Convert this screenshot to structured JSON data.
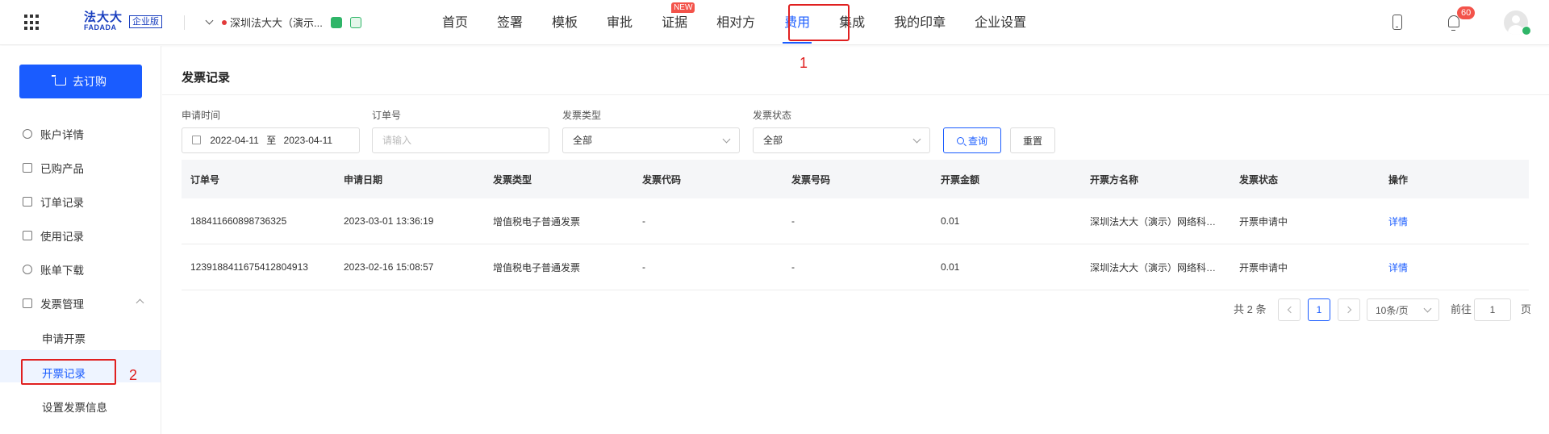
{
  "header": {
    "logo_main": "法大大",
    "logo_sub": "FADADA",
    "logo_tag": "企业版",
    "org_name": "深圳法大大（演示...",
    "nav": [
      {
        "label": "首页"
      },
      {
        "label": "签署"
      },
      {
        "label": "模板"
      },
      {
        "label": "审批"
      },
      {
        "label": "证据",
        "tag": "NEW"
      },
      {
        "label": "相对方"
      },
      {
        "label": "费用",
        "active": true
      },
      {
        "label": "集成"
      },
      {
        "label": "我的印章"
      },
      {
        "label": "企业设置"
      }
    ],
    "notification_count": "60"
  },
  "annotations": {
    "one": "1",
    "two": "2"
  },
  "sidebar": {
    "buy_button": "去订购",
    "items": [
      {
        "label": "账户详情",
        "icon": "user-icon"
      },
      {
        "label": "已购产品",
        "icon": "bar-chart-icon"
      },
      {
        "label": "订单记录",
        "icon": "document-icon"
      },
      {
        "label": "使用记录",
        "icon": "clipboard-icon"
      },
      {
        "label": "账单下载",
        "icon": "download-icon"
      },
      {
        "label": "发票管理",
        "icon": "invoice-icon"
      }
    ],
    "sub_items": [
      {
        "label": "申请开票"
      },
      {
        "label": "开票记录",
        "active": true
      },
      {
        "label": "设置发票信息"
      }
    ]
  },
  "page": {
    "title": "发票记录",
    "filters": {
      "date_label": "申请时间",
      "date_start": "2022-04-11",
      "date_sep": "至",
      "date_end": "2023-04-11",
      "order_label": "订单号",
      "order_placeholder": "请输入",
      "type_label": "发票类型",
      "type_value": "全部",
      "status_label": "发票状态",
      "status_value": "全部",
      "query_button": "查询",
      "reset_button": "重置"
    },
    "table": {
      "columns": [
        "订单号",
        "申请日期",
        "发票类型",
        "发票代码",
        "发票号码",
        "开票金额",
        "开票方名称",
        "发票状态",
        "操作"
      ],
      "rows": [
        [
          "188411660898736325",
          "2023-03-01 13:36:19",
          "增值税电子普通发票",
          "-",
          "-",
          "0.01",
          "深圳法大大（演示）网络科…",
          "开票申请中",
          "详情"
        ],
        [
          "1239188411675412804913",
          "2023-02-16 15:08:57",
          "增值税电子普通发票",
          "-",
          "-",
          "0.01",
          "深圳法大大（演示）网络科…",
          "开票申请中",
          "详情"
        ]
      ]
    },
    "pagination": {
      "total": "共 2 条",
      "current_page": "1",
      "page_size": "10条/页",
      "goto_label": "前往",
      "goto_value": "1",
      "goto_suffix": "页"
    }
  },
  "colors": {
    "primary": "#1a5cff",
    "annotation": "#e02020",
    "badge": "#f3534a"
  }
}
